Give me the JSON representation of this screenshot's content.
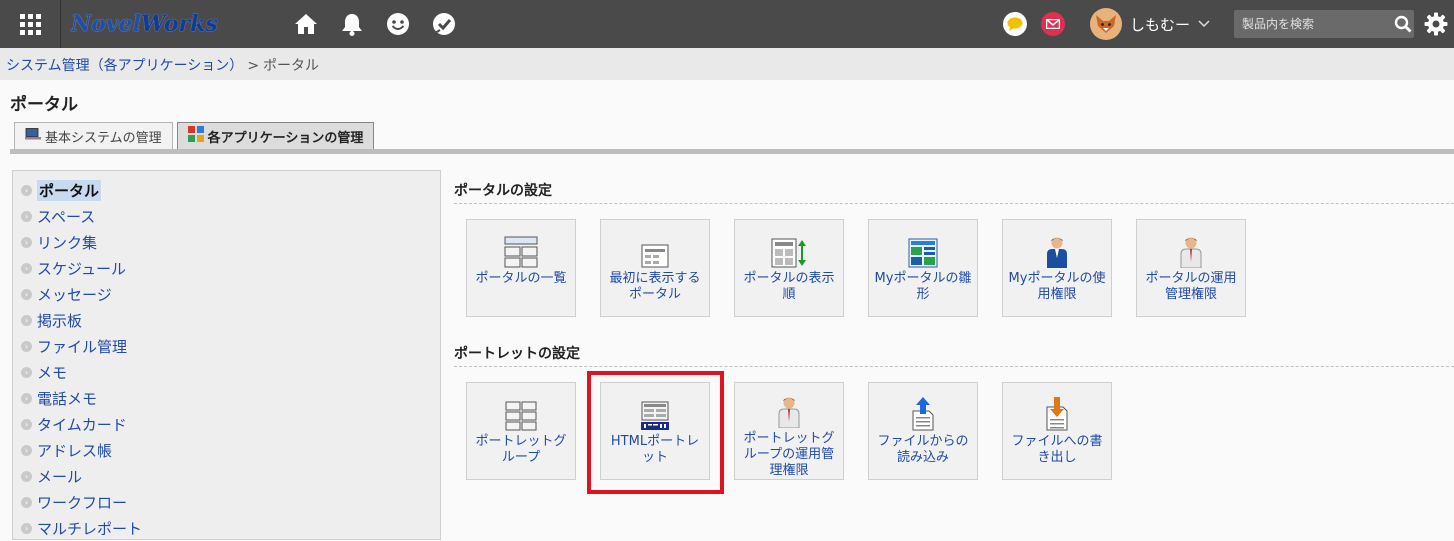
{
  "header": {
    "logo_part1": "Novel",
    "logo_part2": "Works",
    "user_name": "しもむー",
    "search_placeholder": "製品内を検索"
  },
  "breadcrumb": {
    "link": "システム管理（各アプリケーション）",
    "separator": ">",
    "current": "ポータル"
  },
  "page_title": "ポータル",
  "tabs": [
    {
      "label": "基本システムの管理",
      "active": false
    },
    {
      "label": "各アプリケーションの管理",
      "active": true
    }
  ],
  "sidebar": {
    "items": [
      {
        "label": "ポータル",
        "active": true
      },
      {
        "label": "スペース"
      },
      {
        "label": "リンク集"
      },
      {
        "label": "スケジュール"
      },
      {
        "label": "メッセージ"
      },
      {
        "label": "掲示板"
      },
      {
        "label": "ファイル管理"
      },
      {
        "label": "メモ"
      },
      {
        "label": "電話メモ"
      },
      {
        "label": "タイムカード"
      },
      {
        "label": "アドレス帳"
      },
      {
        "label": "メール"
      },
      {
        "label": "ワークフロー"
      },
      {
        "label": "マルチレポート"
      }
    ]
  },
  "portal_settings": {
    "title": "ポータルの設定",
    "cards": [
      {
        "label": "ポータルの一覧",
        "icon": "portal-list-icon"
      },
      {
        "label": "最初に表示するポータル",
        "icon": "initial-portal-icon"
      },
      {
        "label": "ポータルの表示順",
        "icon": "display-order-icon"
      },
      {
        "label": "Myポータルの雛形",
        "icon": "template-icon"
      },
      {
        "label": "Myポータルの使用権限",
        "icon": "person-icon"
      },
      {
        "label": "ポータルの運用管理権限",
        "icon": "admin-person-icon"
      }
    ]
  },
  "portlet_settings": {
    "title": "ポートレットの設定",
    "cards": [
      {
        "label": "ポートレットグループ",
        "icon": "portlet-group-icon"
      },
      {
        "label": "HTMLポートレット",
        "icon": "html-portlet-icon",
        "highlighted": true
      },
      {
        "label": "ポートレットグループの運用管理権限",
        "icon": "admin-person-icon"
      },
      {
        "label": "ファイルからの読み込み",
        "icon": "import-icon"
      },
      {
        "label": "ファイルへの書き出し",
        "icon": "export-icon"
      }
    ]
  },
  "colors": {
    "topbar": "#4a4a4a",
    "link": "#1f4aa8",
    "highlight": "#e0141e"
  }
}
